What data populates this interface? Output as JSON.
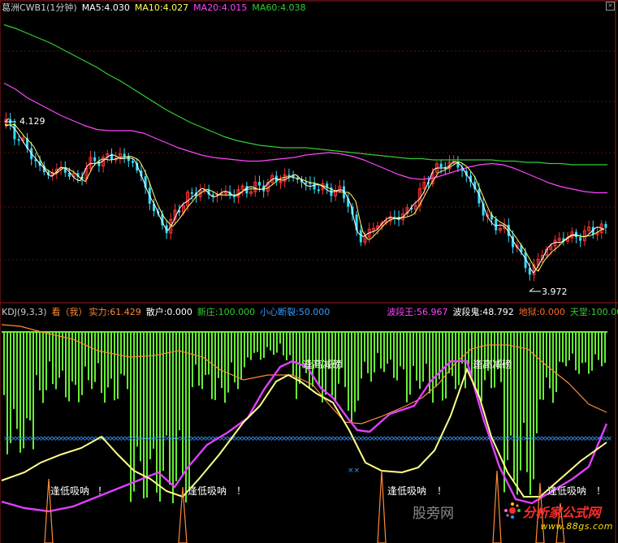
{
  "top_header": {
    "stock": "葛洲CWB1(1分钟)",
    "ma5": "MA5:4.030",
    "ma10": "MA10:4.027",
    "ma20": "MA20:4.015",
    "ma60": "MA60:4.038"
  },
  "price_labels": {
    "high": "4.129",
    "low": "3.972"
  },
  "kdj_header": {
    "name": "KDJ(9,3,3)",
    "look": "看（我）",
    "strength": "实力:61.429",
    "retail": "散户:0.000",
    "newdealer": "新庄:100.000",
    "caution": "小心断裂:50.000",
    "wave_king": "波段王:56.967",
    "wave_ghost": "波段鬼:48.792",
    "hell": "地狱:0.000",
    "heaven": "天堂:100.000"
  },
  "annotations": {
    "high_reduce": "逢高减磅",
    "low_absorb": "逢低吸呐",
    "bang": "！"
  },
  "watermark": "股旁网",
  "logo": {
    "name": "分析家公式网",
    "url": "www.88gs.com"
  },
  "colors": {
    "ma5": "#ffffff",
    "ma10": "#ffff66",
    "ma20": "#ff44ff",
    "ma60": "#33cc33",
    "up": "#ff3333",
    "down": "#33ddff",
    "histogram": "#66ee33",
    "dots": "#3399ff",
    "orange": "#ff8a3a"
  },
  "chart_data": {
    "type": "line",
    "title": "葛洲CWB1(1分钟)",
    "ylim": [
      3.95,
      4.16
    ],
    "series": [
      {
        "name": "MA20",
        "values": [
          4.105,
          4.1,
          4.093,
          4.088,
          4.083,
          4.078,
          4.074,
          4.07,
          4.067,
          4.066,
          4.066,
          4.066,
          4.064,
          4.06,
          4.056,
          4.052,
          4.049,
          4.046,
          4.044,
          4.043,
          4.042,
          4.041,
          4.041,
          4.042,
          4.043,
          4.044,
          4.046,
          4.047,
          4.048,
          4.047,
          4.045,
          4.042,
          4.038,
          4.034,
          4.03,
          4.027,
          4.026,
          4.027,
          4.03,
          4.033,
          4.036,
          4.038,
          4.039,
          4.038,
          4.035,
          4.031,
          4.027,
          4.023,
          4.02,
          4.018,
          4.016,
          4.015,
          4.015
        ]
      },
      {
        "name": "MA60",
        "values": [
          4.153,
          4.15,
          4.146,
          4.142,
          4.138,
          4.133,
          4.128,
          4.123,
          4.118,
          4.112,
          4.107,
          4.101,
          4.095,
          4.089,
          4.083,
          4.078,
          4.073,
          4.069,
          4.065,
          4.061,
          4.058,
          4.056,
          4.054,
          4.053,
          4.052,
          4.052,
          4.052,
          4.051,
          4.05,
          4.049,
          4.048,
          4.047,
          4.046,
          4.045,
          4.044,
          4.043,
          4.043,
          4.042,
          4.042,
          4.042,
          4.042,
          4.042,
          4.042,
          4.041,
          4.041,
          4.04,
          4.04,
          4.039,
          4.039,
          4.038,
          4.038,
          4.038,
          4.038
        ]
      }
    ]
  }
}
